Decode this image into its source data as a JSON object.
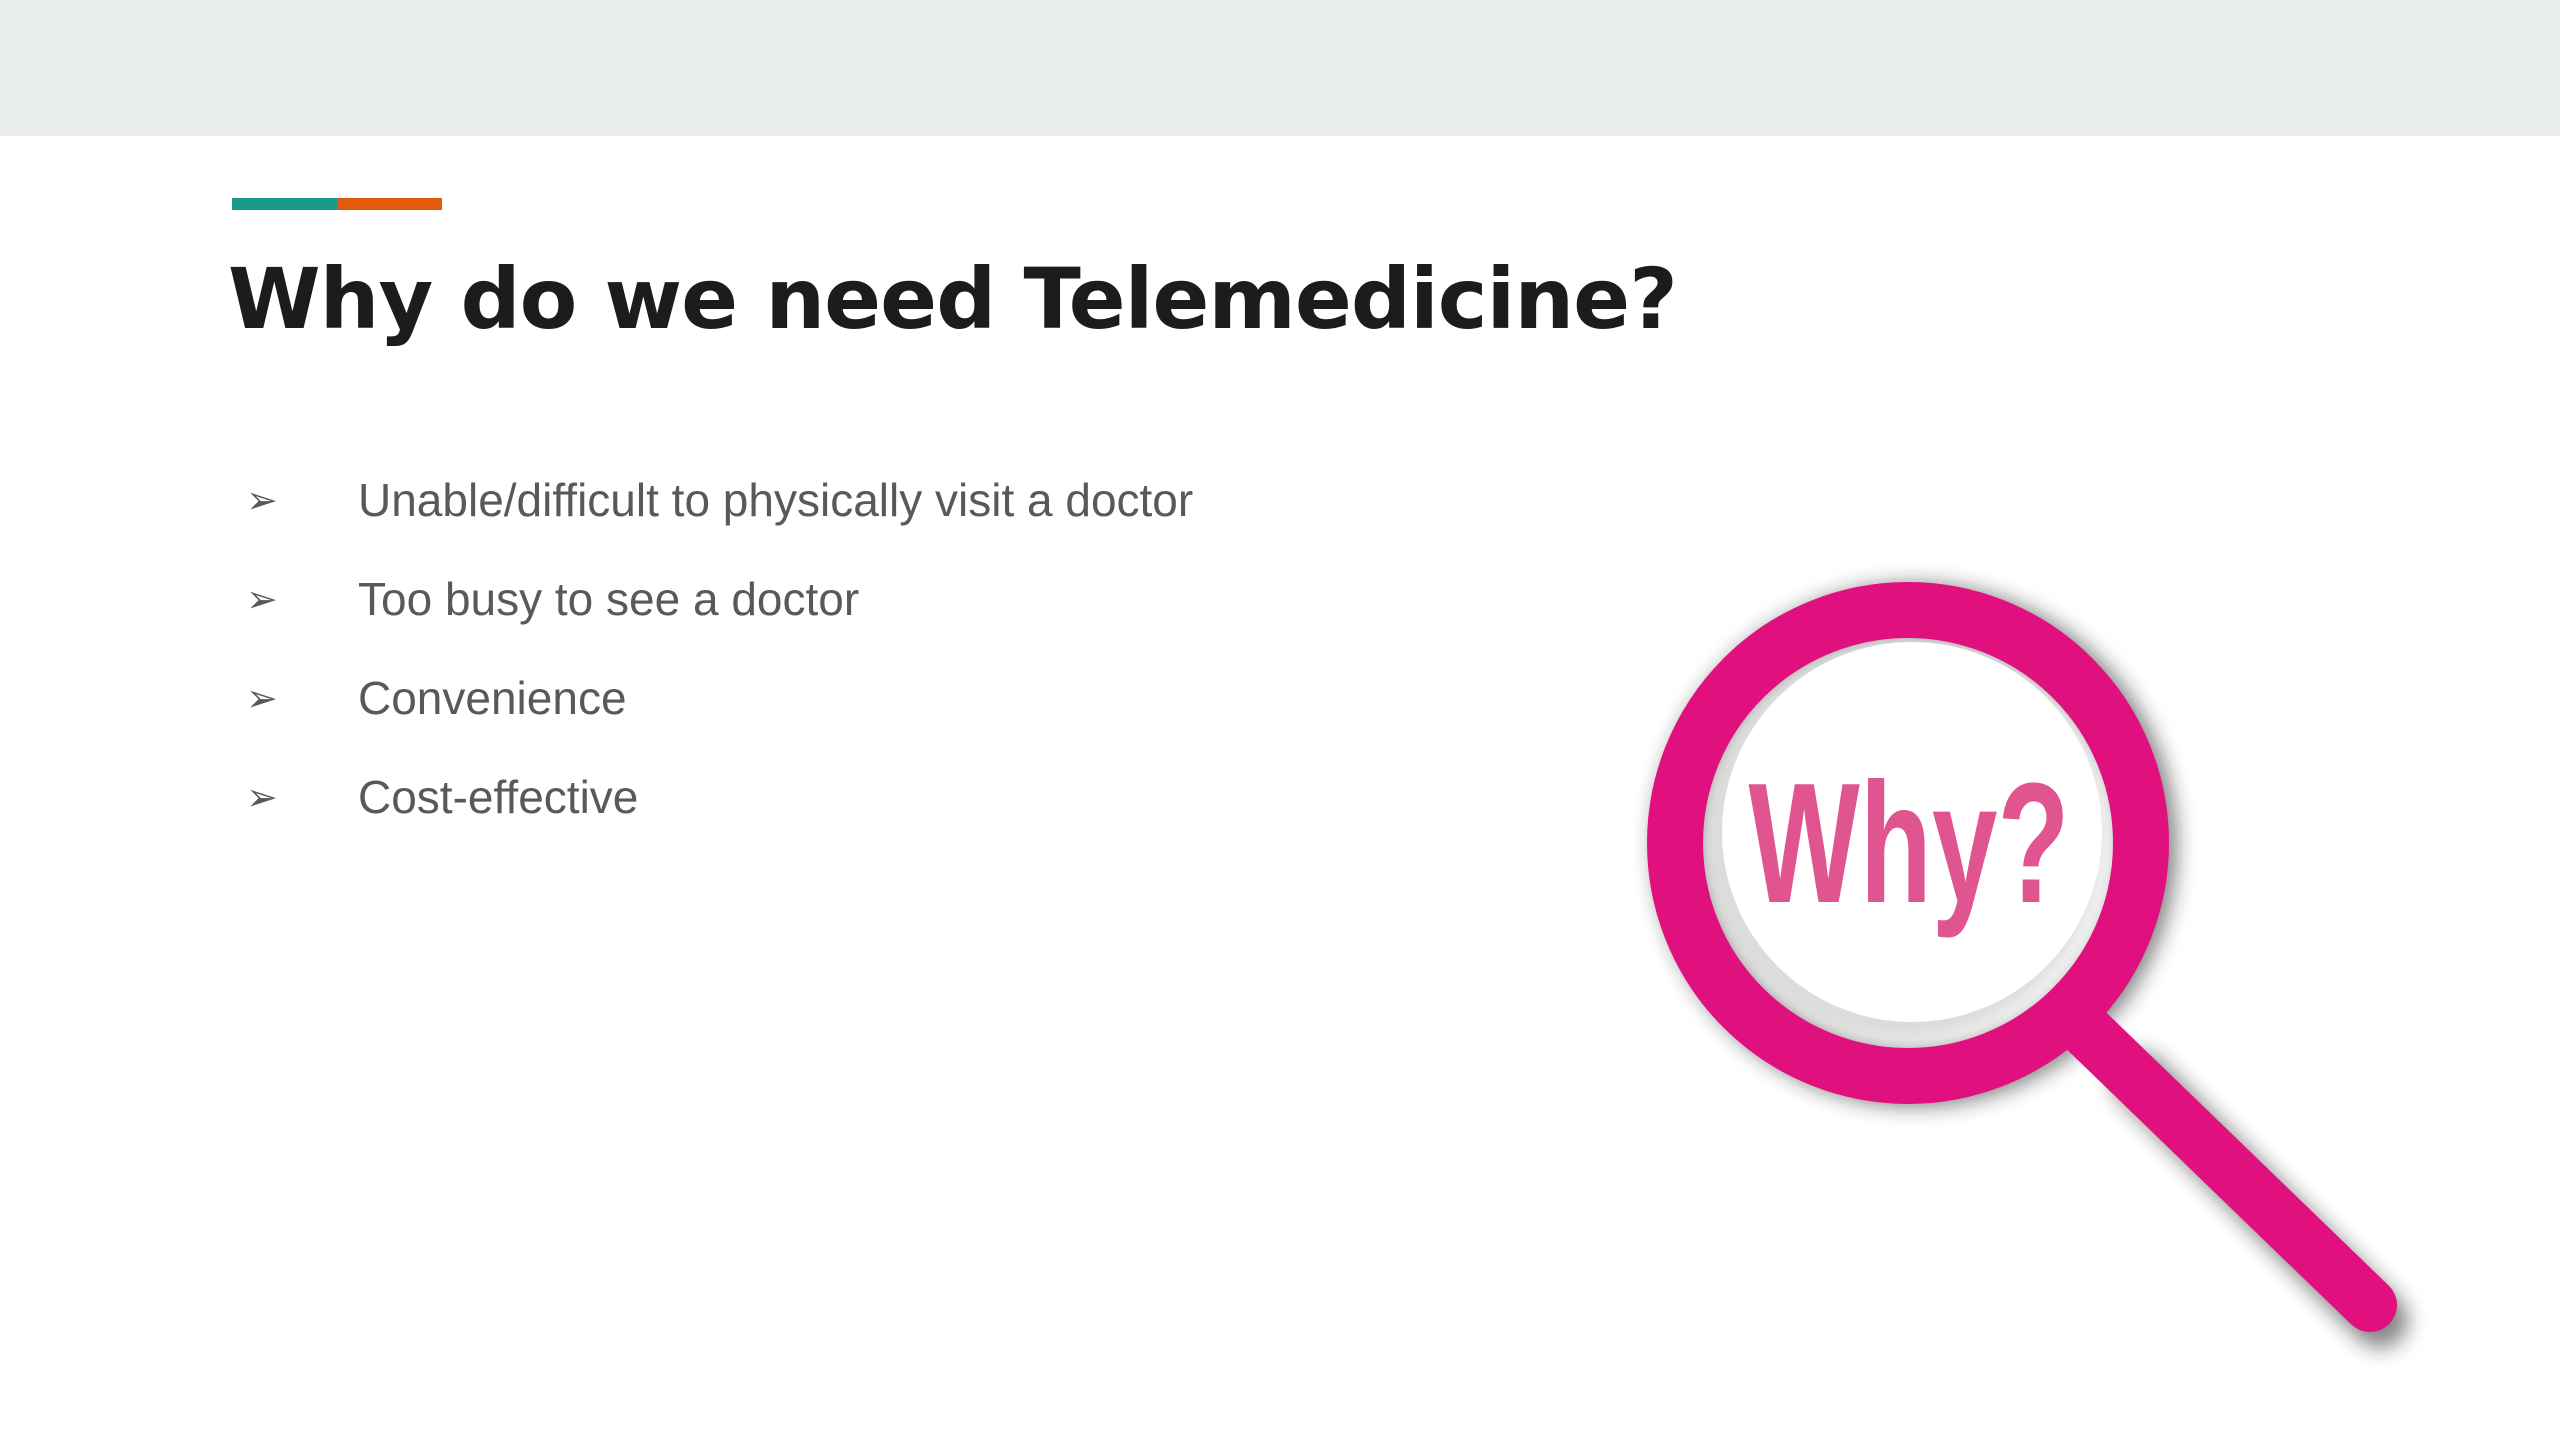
{
  "slide": {
    "title": "Why do we need Telemedicine?",
    "accent_colors": [
      "#1b9a8a",
      "#e25a0e"
    ],
    "bullet_icon": "arrowhead-right-icon",
    "bullets": [
      {
        "text": "Unable/difficult to physically visit a doctor"
      },
      {
        "text": "Too busy to see a doctor"
      },
      {
        "text": "Convenience"
      },
      {
        "text": "Cost-effective"
      }
    ]
  },
  "illustration": {
    "icon": "magnifying-glass-icon",
    "lens_text": "Why?",
    "ring_color": "#e0117f",
    "text_color": "#e0558f"
  },
  "colors": {
    "topbar": "#e9edee",
    "title": "#1c1c1c",
    "body_text": "#595959"
  }
}
